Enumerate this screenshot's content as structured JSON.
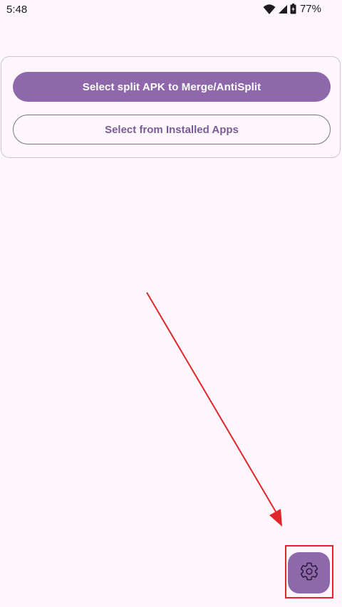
{
  "status_bar": {
    "time": "5:48",
    "battery_percent": "77%",
    "icons": [
      "wifi-icon",
      "signal-icon",
      "battery-icon"
    ]
  },
  "main_card": {
    "primary_button_label": "Select split APK to Merge/AntiSplit",
    "secondary_button_label": "Select from Installed Apps"
  },
  "fab": {
    "icon": "gear-icon"
  },
  "colors": {
    "background": "#fdf7fd",
    "primary": "#8e68aa",
    "outline_text": "#7b5b96",
    "annotation": "#e0262b"
  }
}
